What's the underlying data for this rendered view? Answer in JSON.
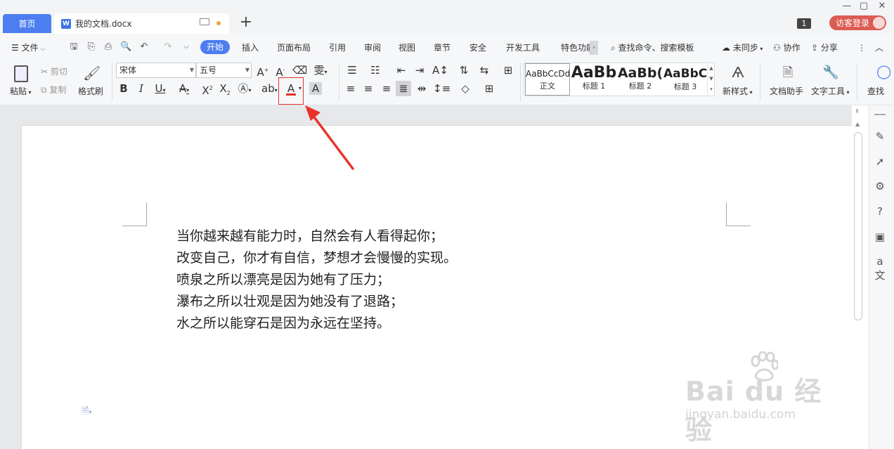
{
  "tabs": {
    "home": "首页",
    "doc_title": "我的文档.docx",
    "doc_icon": "W",
    "add": "+"
  },
  "titlebar": {
    "badge": "1",
    "login": "访客登录",
    "window_buttons": [
      "—",
      "▢",
      "✕"
    ]
  },
  "menu": {
    "file": "文件",
    "items": [
      "开始",
      "插入",
      "页面布局",
      "引用",
      "审阅",
      "视图",
      "章节",
      "安全",
      "开发工具",
      "特色功能"
    ],
    "active": "开始",
    "search": "查找命令、搜索模板",
    "sync": "未同步",
    "collab": "协作",
    "share": "分享"
  },
  "ribbon": {
    "paste": "粘贴",
    "cut": "剪切",
    "copy": "复制",
    "format_painter": "格式刷",
    "font_name": "宋体",
    "font_size": "五号",
    "styles": [
      {
        "preview": "AaBbCcDd",
        "name": "正文"
      },
      {
        "preview": "AaBb",
        "name": "标题 1"
      },
      {
        "preview": "AaBb(",
        "name": "标题 2"
      },
      {
        "preview": "AaBbC(",
        "name": "标题 3"
      }
    ],
    "new_style": "新样式",
    "doc_assistant": "文档助手",
    "text_tools": "文字工具",
    "find": "查找",
    "font_color_icon": "A",
    "accent": "#4c7ef0",
    "highlight_color": "#e0322a"
  },
  "document": {
    "lines": [
      "当你越来越有能力时，自然会有人看得起你；",
      "改变自己，你才有自信，梦想才会慢慢的实现。",
      "喷泉之所以漂亮是因为她有了压力；",
      "瀑布之所以壮观是因为她没有了退路；",
      "水之所以能穿石是因为永远在坚持。"
    ]
  },
  "watermark": {
    "brand": "Bai du 经验",
    "url": "jingyan.baidu.com"
  }
}
